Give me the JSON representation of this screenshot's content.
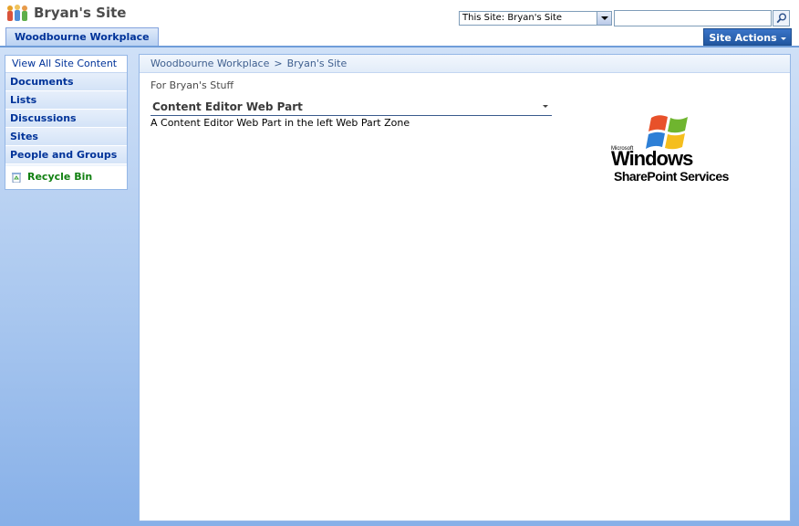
{
  "header": {
    "site_title": "Bryan's Site",
    "search_scope": "This Site: Bryan's Site",
    "search_placeholder": ""
  },
  "tabs": {
    "home": "Woodbourne Workplace",
    "site_actions": "Site Actions"
  },
  "quick_launch": {
    "view_all": "View All Site Content",
    "headings": [
      "Documents",
      "Lists",
      "Discussions",
      "Sites",
      "People and Groups"
    ],
    "recycle_bin": "Recycle Bin"
  },
  "breadcrumb": {
    "root": "Woodbourne Workplace",
    "separator": ">",
    "current": "Bryan's Site"
  },
  "content": {
    "zone_title": "For Bryan's Stuff",
    "webpart_title": "Content Editor Web Part",
    "webpart_body": "A Content Editor Web Part in the left Web Part Zone"
  },
  "logo": {
    "microsoft": "Microsoft",
    "windows": "Windows",
    "product": "SharePoint Services"
  },
  "colors": {
    "link_blue": "#003399",
    "recycle_green": "#118011",
    "site_actions_bg": "#21569f",
    "body_gradient_top": "#cfe0f7",
    "body_gradient_bottom": "#87b0e8"
  }
}
